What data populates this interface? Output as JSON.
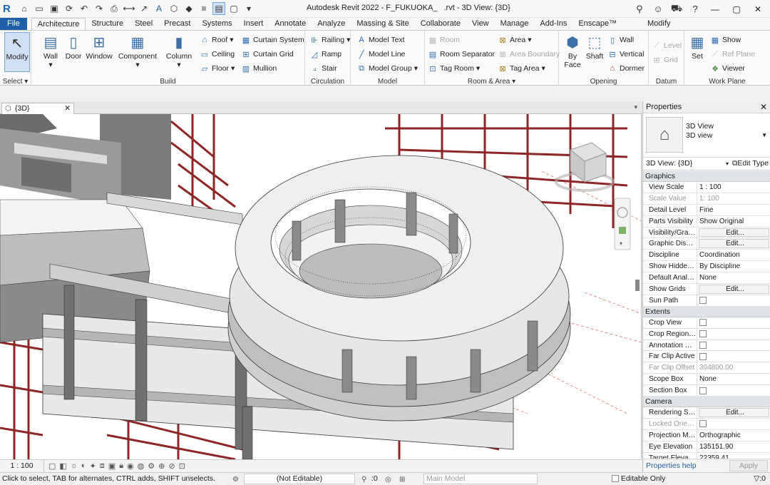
{
  "title": {
    "app": "Autodesk Revit 2022 - F_FUKUOKA_",
    "doc": ".rvt - 3D View: {3D}"
  },
  "tabs": [
    "File",
    "Architecture",
    "Structure",
    "Steel",
    "Precast",
    "Systems",
    "Insert",
    "Annotate",
    "Analyze",
    "Massing & Site",
    "Collaborate",
    "View",
    "Manage",
    "Add-Ins",
    "Enscape™"
  ],
  "context_tab": "Modify",
  "ribbon": {
    "select": {
      "modify": "Modify",
      "label": "Select"
    },
    "build": {
      "label": "Build",
      "wall": "Wall",
      "door": "Door",
      "window": "Window",
      "component": "Component",
      "column": "Column",
      "roof": "Roof",
      "ceiling": "Ceiling",
      "floor": "Floor",
      "curtain_system": "Curtain System",
      "curtain_grid": "Curtain Grid",
      "mullion": "Mullion"
    },
    "circulation": {
      "label": "Circulation",
      "railing": "Railing",
      "ramp": "Ramp",
      "stair": "Stair"
    },
    "model": {
      "label": "Model",
      "model_text": "Model  Text",
      "model_line": "Model  Line",
      "model_group": "Model  Group"
    },
    "room_area": {
      "label": "Room & Area",
      "room": "Room",
      "room_separator": "Room  Separator",
      "tag_room": "Tag  Room",
      "area": "Area",
      "area_boundary": "Area  Boundary",
      "tag_area": "Tag  Area"
    },
    "opening": {
      "label": "Opening",
      "by_face": "By Face",
      "shaft": "Shaft",
      "wall": "Wall",
      "vertical": "Vertical",
      "dormer": "Dormer"
    },
    "datum": {
      "label": "Datum",
      "level": "Level",
      "grid": "Grid"
    },
    "work_plane": {
      "label": "Work Plane",
      "set": "Set",
      "show": "Show",
      "ref_plane": "Ref  Plane",
      "viewer": "Viewer"
    }
  },
  "view_tab": "{3D}",
  "view_scale": "1 : 100",
  "properties": {
    "header": "Properties",
    "type_line1": "3D View",
    "type_line2": "3D view",
    "selector": "3D View: {3D}",
    "edit_type": "Edit Type",
    "sections": [
      {
        "name": "Graphics",
        "rows": [
          {
            "k": "View Scale",
            "v": "1 : 100"
          },
          {
            "k": "Scale Value",
            "v": "1:  100",
            "dis": true
          },
          {
            "k": "Detail Level",
            "v": "Fine"
          },
          {
            "k": "Parts Visibility",
            "v": "Show Original"
          },
          {
            "k": "Visibility/Grap...",
            "v": "Edit...",
            "btn": true
          },
          {
            "k": "Graphic Displa...",
            "v": "Edit...",
            "btn": true
          },
          {
            "k": "Discipline",
            "v": "Coordination"
          },
          {
            "k": "Show Hidden ...",
            "v": "By Discipline"
          },
          {
            "k": "Default Analys...",
            "v": "None"
          },
          {
            "k": "Show Grids",
            "v": "Edit...",
            "btn": true
          },
          {
            "k": "Sun Path",
            "v": "",
            "chk": true
          }
        ]
      },
      {
        "name": "Extents",
        "rows": [
          {
            "k": "Crop View",
            "v": "",
            "chk": true
          },
          {
            "k": "Crop Region V...",
            "v": "",
            "chk": true
          },
          {
            "k": "Annotation Cr...",
            "v": "",
            "chk": true
          },
          {
            "k": "Far Clip Active",
            "v": "",
            "chk": true
          },
          {
            "k": "Far Clip Offset",
            "v": "304800.00",
            "dis": true
          },
          {
            "k": "Scope Box",
            "v": "None"
          },
          {
            "k": "Section Box",
            "v": "",
            "chk": true
          }
        ]
      },
      {
        "name": "Camera",
        "rows": [
          {
            "k": "Rendering Sett...",
            "v": "Edit...",
            "btn": true
          },
          {
            "k": "Locked Orient...",
            "v": "",
            "chk": true,
            "dis": true
          },
          {
            "k": "Projection Mo...",
            "v": "Orthographic"
          },
          {
            "k": "Eye Elevation",
            "v": "135151.90"
          },
          {
            "k": "Target Elevation",
            "v": "22359.41"
          }
        ]
      }
    ],
    "help": "Properties help",
    "apply": "Apply"
  },
  "status": {
    "message": "Click to select, TAB for alternates, CTRL adds, SHIFT unselects.",
    "workset": "(Not Editable)",
    "count": ":0",
    "model": "Main Model",
    "editable": "Editable Only",
    "filter": ":0"
  },
  "colors": {
    "accent": "#1f5fa8",
    "steel": "#9e2b2b",
    "concrete": "#d9d9d9"
  }
}
